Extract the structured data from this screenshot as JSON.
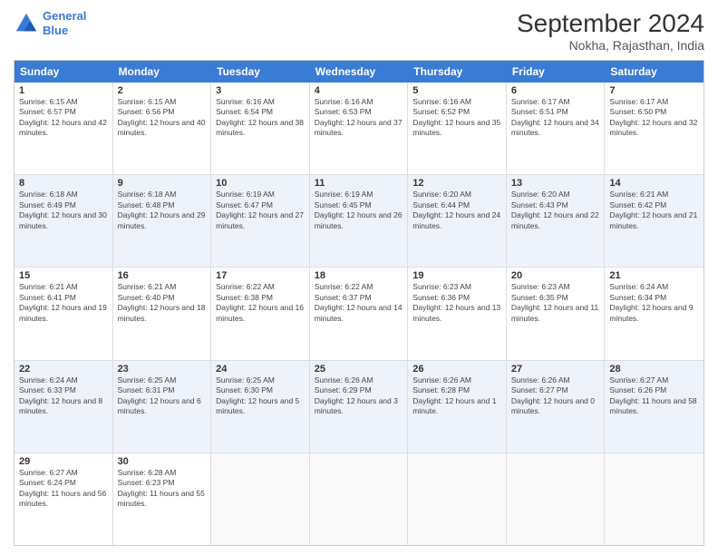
{
  "header": {
    "logo_line1": "General",
    "logo_line2": "Blue",
    "title": "September 2024",
    "subtitle": "Nokha, Rajasthan, India"
  },
  "calendar": {
    "days_of_week": [
      "Sunday",
      "Monday",
      "Tuesday",
      "Wednesday",
      "Thursday",
      "Friday",
      "Saturday"
    ],
    "weeks": [
      {
        "alt": false,
        "days": [
          {
            "num": "1",
            "rise": "6:15 AM",
            "set": "6:57 PM",
            "daylight": "12 hours and 42 minutes."
          },
          {
            "num": "2",
            "rise": "6:15 AM",
            "set": "6:56 PM",
            "daylight": "12 hours and 40 minutes."
          },
          {
            "num": "3",
            "rise": "6:16 AM",
            "set": "6:54 PM",
            "daylight": "12 hours and 38 minutes."
          },
          {
            "num": "4",
            "rise": "6:16 AM",
            "set": "6:53 PM",
            "daylight": "12 hours and 37 minutes."
          },
          {
            "num": "5",
            "rise": "6:16 AM",
            "set": "6:52 PM",
            "daylight": "12 hours and 35 minutes."
          },
          {
            "num": "6",
            "rise": "6:17 AM",
            "set": "6:51 PM",
            "daylight": "12 hours and 34 minutes."
          },
          {
            "num": "7",
            "rise": "6:17 AM",
            "set": "6:50 PM",
            "daylight": "12 hours and 32 minutes."
          }
        ]
      },
      {
        "alt": true,
        "days": [
          {
            "num": "8",
            "rise": "6:18 AM",
            "set": "6:49 PM",
            "daylight": "12 hours and 30 minutes."
          },
          {
            "num": "9",
            "rise": "6:18 AM",
            "set": "6:48 PM",
            "daylight": "12 hours and 29 minutes."
          },
          {
            "num": "10",
            "rise": "6:19 AM",
            "set": "6:47 PM",
            "daylight": "12 hours and 27 minutes."
          },
          {
            "num": "11",
            "rise": "6:19 AM",
            "set": "6:45 PM",
            "daylight": "12 hours and 26 minutes."
          },
          {
            "num": "12",
            "rise": "6:20 AM",
            "set": "6:44 PM",
            "daylight": "12 hours and 24 minutes."
          },
          {
            "num": "13",
            "rise": "6:20 AM",
            "set": "6:43 PM",
            "daylight": "12 hours and 22 minutes."
          },
          {
            "num": "14",
            "rise": "6:21 AM",
            "set": "6:42 PM",
            "daylight": "12 hours and 21 minutes."
          }
        ]
      },
      {
        "alt": false,
        "days": [
          {
            "num": "15",
            "rise": "6:21 AM",
            "set": "6:41 PM",
            "daylight": "12 hours and 19 minutes."
          },
          {
            "num": "16",
            "rise": "6:21 AM",
            "set": "6:40 PM",
            "daylight": "12 hours and 18 minutes."
          },
          {
            "num": "17",
            "rise": "6:22 AM",
            "set": "6:38 PM",
            "daylight": "12 hours and 16 minutes."
          },
          {
            "num": "18",
            "rise": "6:22 AM",
            "set": "6:37 PM",
            "daylight": "12 hours and 14 minutes."
          },
          {
            "num": "19",
            "rise": "6:23 AM",
            "set": "6:36 PM",
            "daylight": "12 hours and 13 minutes."
          },
          {
            "num": "20",
            "rise": "6:23 AM",
            "set": "6:35 PM",
            "daylight": "12 hours and 11 minutes."
          },
          {
            "num": "21",
            "rise": "6:24 AM",
            "set": "6:34 PM",
            "daylight": "12 hours and 9 minutes."
          }
        ]
      },
      {
        "alt": true,
        "days": [
          {
            "num": "22",
            "rise": "6:24 AM",
            "set": "6:33 PM",
            "daylight": "12 hours and 8 minutes."
          },
          {
            "num": "23",
            "rise": "6:25 AM",
            "set": "6:31 PM",
            "daylight": "12 hours and 6 minutes."
          },
          {
            "num": "24",
            "rise": "6:25 AM",
            "set": "6:30 PM",
            "daylight": "12 hours and 5 minutes."
          },
          {
            "num": "25",
            "rise": "6:26 AM",
            "set": "6:29 PM",
            "daylight": "12 hours and 3 minutes."
          },
          {
            "num": "26",
            "rise": "6:26 AM",
            "set": "6:28 PM",
            "daylight": "12 hours and 1 minute."
          },
          {
            "num": "27",
            "rise": "6:26 AM",
            "set": "6:27 PM",
            "daylight": "12 hours and 0 minutes."
          },
          {
            "num": "28",
            "rise": "6:27 AM",
            "set": "6:26 PM",
            "daylight": "11 hours and 58 minutes."
          }
        ]
      },
      {
        "alt": false,
        "days": [
          {
            "num": "29",
            "rise": "6:27 AM",
            "set": "6:24 PM",
            "daylight": "11 hours and 56 minutes."
          },
          {
            "num": "30",
            "rise": "6:28 AM",
            "set": "6:23 PM",
            "daylight": "11 hours and 55 minutes."
          },
          {
            "num": "",
            "rise": "",
            "set": "",
            "daylight": ""
          },
          {
            "num": "",
            "rise": "",
            "set": "",
            "daylight": ""
          },
          {
            "num": "",
            "rise": "",
            "set": "",
            "daylight": ""
          },
          {
            "num": "",
            "rise": "",
            "set": "",
            "daylight": ""
          },
          {
            "num": "",
            "rise": "",
            "set": "",
            "daylight": ""
          }
        ]
      }
    ]
  }
}
